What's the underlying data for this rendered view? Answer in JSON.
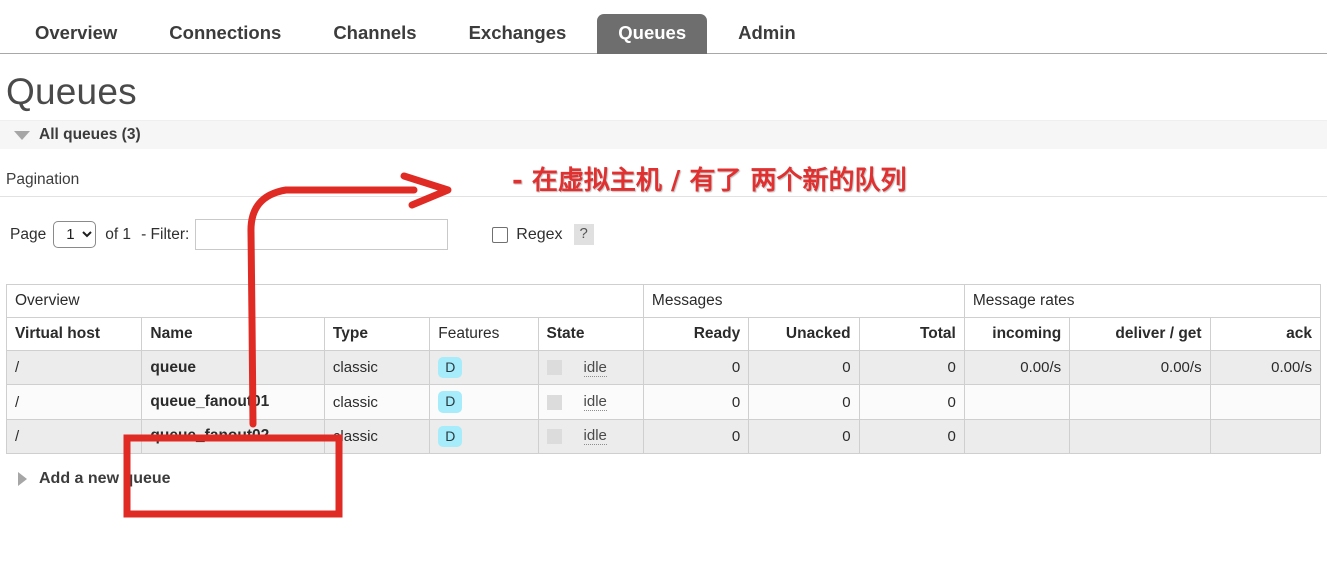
{
  "nav": {
    "items": [
      {
        "label": "Overview",
        "active": false
      },
      {
        "label": "Connections",
        "active": false
      },
      {
        "label": "Channels",
        "active": false
      },
      {
        "label": "Exchanges",
        "active": false
      },
      {
        "label": "Queues",
        "active": true
      },
      {
        "label": "Admin",
        "active": false
      }
    ]
  },
  "page": {
    "title": "Queues",
    "section_label": "All queues (3)",
    "pagination_label": "Pagination",
    "add_queue_label": "Add a new queue"
  },
  "pagination": {
    "page_label": "Page",
    "page_value": "1",
    "page_options": [
      "1"
    ],
    "of_label": "of 1",
    "filter_label": "- Filter:",
    "filter_value": "",
    "filter_placeholder": "",
    "regex_label": "Regex",
    "help_label": "?"
  },
  "table": {
    "group_headers": [
      {
        "label": "Overview",
        "span": 5
      },
      {
        "label": "Messages",
        "span": 3
      },
      {
        "label": "Message rates",
        "span": 3
      }
    ],
    "columns": [
      {
        "label": "Virtual host",
        "align": "left",
        "bold": true
      },
      {
        "label": "Name",
        "align": "left",
        "bold": true
      },
      {
        "label": "Type",
        "align": "left",
        "bold": true
      },
      {
        "label": "Features",
        "align": "left",
        "bold": false
      },
      {
        "label": "State",
        "align": "left",
        "bold": true
      },
      {
        "label": "Ready",
        "align": "right",
        "bold": true
      },
      {
        "label": "Unacked",
        "align": "right",
        "bold": true
      },
      {
        "label": "Total",
        "align": "right",
        "bold": true
      },
      {
        "label": "incoming",
        "align": "right",
        "bold": true
      },
      {
        "label": "deliver / get",
        "align": "right",
        "bold": true
      },
      {
        "label": "ack",
        "align": "right",
        "bold": true
      }
    ],
    "rows": [
      {
        "vhost": "/",
        "name": "queue",
        "type": "classic",
        "features": "D",
        "state": "idle",
        "ready": "0",
        "unacked": "0",
        "total": "0",
        "incoming": "0.00/s",
        "deliver_get": "0.00/s",
        "ack": "0.00/s"
      },
      {
        "vhost": "/",
        "name": "queue_fanout01",
        "type": "classic",
        "features": "D",
        "state": "idle",
        "ready": "0",
        "unacked": "0",
        "total": "0",
        "incoming": "",
        "deliver_get": "",
        "ack": ""
      },
      {
        "vhost": "/",
        "name": "queue_fanout02",
        "type": "classic",
        "features": "D",
        "state": "idle",
        "ready": "0",
        "unacked": "0",
        "total": "0",
        "incoming": "",
        "deliver_get": "",
        "ack": ""
      }
    ]
  },
  "annotation": {
    "text": "- 在虚拟主机 / 有了 两个新的队列",
    "color": "#e03030"
  },
  "colors": {
    "active_tab": "#6e6e6e",
    "feature_badge": "#a6ecfb",
    "annotation_red": "#e03030",
    "row_stripe": "#ececec"
  }
}
